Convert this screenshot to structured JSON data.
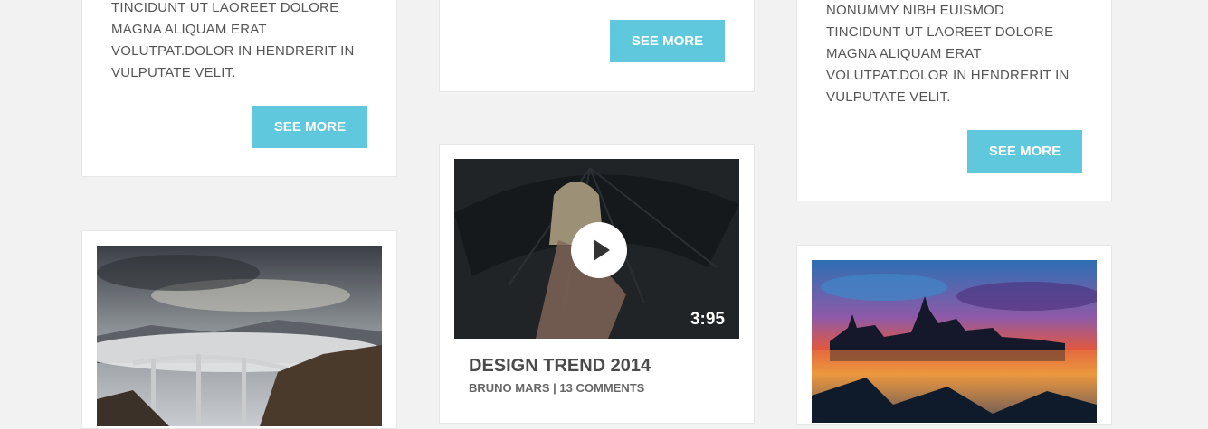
{
  "col1": {
    "post_top": {
      "excerpt_lines": [
        "TINCIDUNT UT LAOREET DOLORE",
        "MAGNA ALIQUAM ERAT",
        "VOLUTPAT.DOLOR IN HENDRERIT IN",
        "VULPUTATE VELIT."
      ],
      "button": "SEE MORE"
    }
  },
  "col2": {
    "post_top": {
      "button": "SEE MORE"
    },
    "video_post": {
      "duration": "3:95",
      "title": "DESIGN TREND 2014",
      "meta": "BRUNO MARS | 13 COMMENTS"
    }
  },
  "col3": {
    "post_top": {
      "excerpt_lines": [
        "NONUMMY NIBH EUISMOD",
        "TINCIDUNT UT LAOREET DOLORE",
        "MAGNA ALIQUAM ERAT",
        "VOLUTPAT.DOLOR IN HENDRERIT IN",
        "VULPUTATE VELIT."
      ],
      "button": "SEE MORE"
    }
  },
  "colors": {
    "accent": "#5fc8dc",
    "background": "#f2f2f2"
  }
}
